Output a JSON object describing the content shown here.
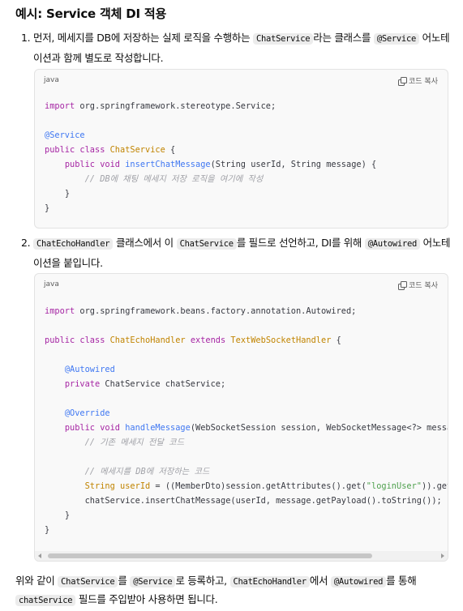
{
  "title": "예시: Service 객체 DI 적용",
  "step1": {
    "num": "1.",
    "p1": "먼저, 메세지를 DB에 저장하는 실제 로직을 수행하는 ",
    "c1": "ChatService",
    "p2": "라는 클래스를 ",
    "c2": "@Service",
    "p3": " 어노테이션과 함께 별도로 작성합니다."
  },
  "code1": {
    "lang": "java",
    "copy_label": "코드 복사",
    "l1_kw": "import",
    "l1_rest": " org.springframework.stereotype.Service;",
    "l3_an": "@Service",
    "l4_kw": "public class",
    "l4_cls": "ChatService",
    "l4_rest": " {",
    "l5_kw": "public void",
    "l5_fn": "insertChatMessage",
    "l5_rest": "(String userId, String message) {",
    "l6_cm": "// DB에 채팅 메세지 저장 로직을 여기에 작성",
    "l7": "}",
    "l8": "}"
  },
  "step2": {
    "num": "2.",
    "c1": "ChatEchoHandler",
    "p1": " 클래스에서 이 ",
    "c2": "ChatService",
    "p2": "를 필드로 선언하고, DI를 위해 ",
    "c3": "@Autowired",
    "p3": " 어노테이션을 붙입니다."
  },
  "code2": {
    "lang": "java",
    "copy_label": "코드 복사",
    "l1_kw": "import",
    "l1_rest": " org.springframework.beans.factory.annotation.Autowired;",
    "l3_kw": "public class",
    "l3_cls": "ChatEchoHandler",
    "l3_kw2": "extends",
    "l3_cls2": "TextWebSocketHandler",
    "l3_rest": " {",
    "l5_an": "@Autowired",
    "l6_kw": "private",
    "l6_rest": " ChatService chatService;",
    "l8_an": "@Override",
    "l9_kw": "public void",
    "l9_fn": "handleMessage",
    "l9_rest": "(WebSocketSession session, WebSocketMessage<?> message) t",
    "l10_cm": "// 기존 메세지 전달 코드",
    "l12_cm": "// 메세지를 DB에 저장하는 코드",
    "l13_ty": "String",
    "l13_var": "userId",
    "l13_rest": " = ((MemberDto)session.getAttributes().get(",
    "l13_str": "\"loginUser\"",
    "l13_rest2": ")).getUserI",
    "l14": "chatService.insertChatMessage(userId, message.getPayload().toString());",
    "l15": "}",
    "l16": "}"
  },
  "footer": {
    "p1": "위와 같이 ",
    "c1": "ChatService",
    "p2": "를 ",
    "c2": "@Service",
    "p3": "로 등록하고, ",
    "c3": "ChatEchoHandler",
    "p4": "에서 ",
    "c4": "@Autowired",
    "p5": "를 통해",
    "c5": "chatService",
    "p6": " 필드를 주입받아 사용하면 됩니다."
  }
}
